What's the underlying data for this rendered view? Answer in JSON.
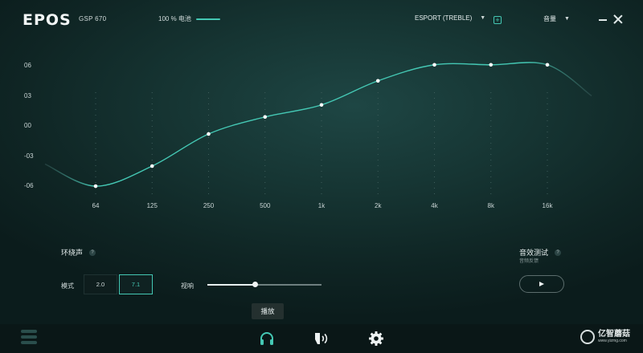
{
  "header": {
    "logo": "EPOS",
    "device": "GSP 670",
    "battery_text": "100 % 电池",
    "preset": "ESPORT (TREBLE)",
    "volume": "音量"
  },
  "chart_data": {
    "type": "line",
    "x": [
      "64",
      "125",
      "250",
      "500",
      "1k",
      "2k",
      "4k",
      "8k",
      "16k"
    ],
    "y": [
      -6,
      -4,
      -0.8,
      0.9,
      2.1,
      4.5,
      6.1,
      6.1,
      6.1
    ],
    "ytick_labels": [
      "06",
      "03",
      "00",
      "-03",
      "-06"
    ],
    "ytick_values": [
      6,
      3,
      0,
      -3,
      -6
    ],
    "ylim": [
      -7,
      7
    ],
    "grid": "dotted-vertical",
    "accent": "#44c8b4"
  },
  "surround": {
    "title": "环绕声",
    "help": "?",
    "mode_label": "模式",
    "modes": [
      "2.0",
      "7.1"
    ],
    "active_mode": "7.1",
    "slider_label": "视响",
    "slider_value": 0.42
  },
  "sound_test": {
    "title": "音效测试",
    "help": "?",
    "subtitle": "音频反馈"
  },
  "tooltip": "播放",
  "watermark": {
    "text": "亿智蘑菇",
    "sub": "www.yizmg.com"
  }
}
